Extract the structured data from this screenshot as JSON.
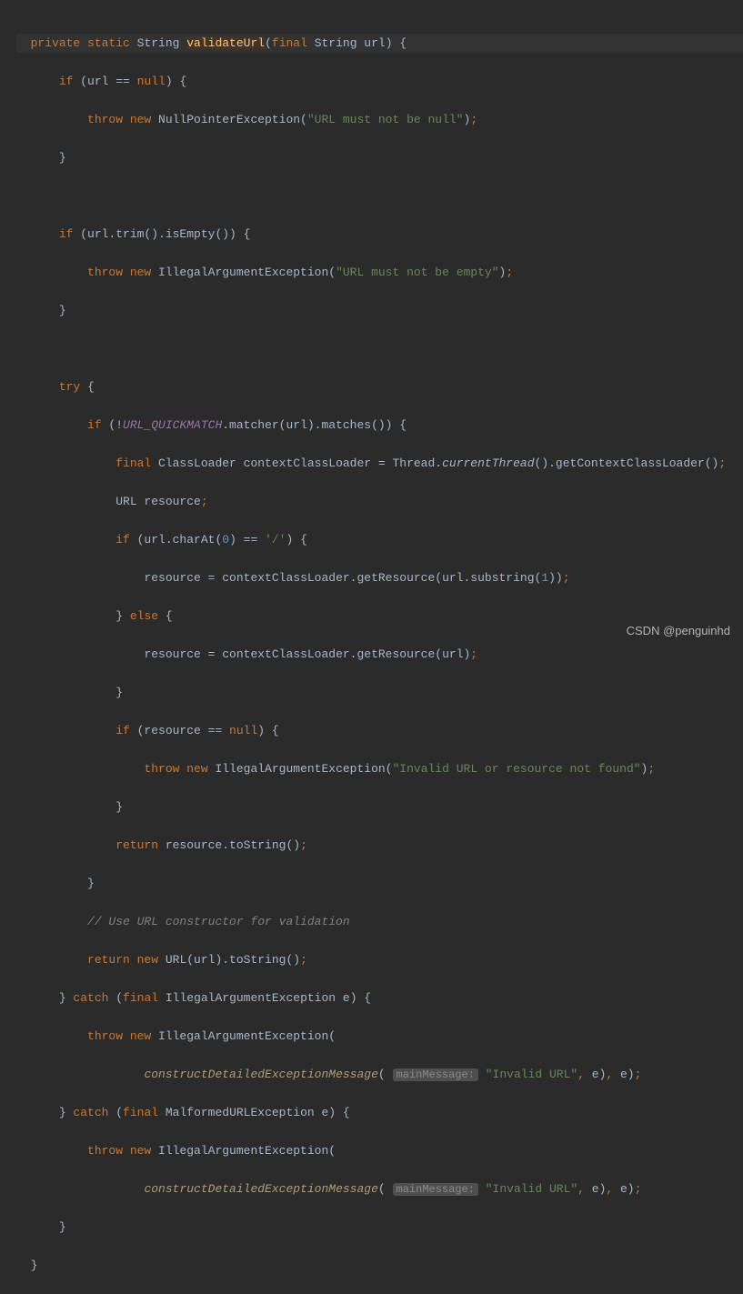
{
  "code": {
    "l1": {
      "a": "private static ",
      "b": "String ",
      "c": "validateUrl",
      "d": "(",
      "e": "final ",
      "f": "String url) {"
    },
    "l2": {
      "a": "if ",
      "b": "(url == ",
      "c": "null",
      "d": ") {"
    },
    "l3": {
      "a": "throw new ",
      "b": "NullPointerException(",
      "c": "\"URL must not be null\"",
      "d": ")",
      "e": ";"
    },
    "l4": {
      "a": "}"
    },
    "l5": {
      "a": "if ",
      "b": "(url.trim().isEmpty()) {"
    },
    "l6": {
      "a": "throw new ",
      "b": "IllegalArgumentException(",
      "c": "\"URL must not be empty\"",
      "d": ")",
      "e": ";"
    },
    "l7": {
      "a": "}"
    },
    "l8": {
      "a": "try ",
      "b": "{"
    },
    "l9": {
      "a": "if ",
      "b": "(!",
      "c": "URL_QUICKMATCH",
      "d": ".matcher(url).matches()) {"
    },
    "l10": {
      "a": "final ",
      "b": "ClassLoader contextClassLoader = Thread.",
      "c": "currentThread",
      "d": "().getContextClassLoader()",
      "e": ";"
    },
    "l11": {
      "a": "URL resource",
      "b": ";"
    },
    "l12": {
      "a": "if ",
      "b": "(url.charAt(",
      "c": "0",
      "d": ") == ",
      "e": "'/'",
      "f": ") {"
    },
    "l13": {
      "a": "resource = contextClassLoader.getResource(url.substring(",
      "b": "1",
      "c": "))",
      "d": ";"
    },
    "l14": {
      "a": "} ",
      "b": "else ",
      "c": "{"
    },
    "l15": {
      "a": "resource = contextClassLoader.getResource(url)",
      "b": ";"
    },
    "l16": {
      "a": "}"
    },
    "l17": {
      "a": "if ",
      "b": "(resource == ",
      "c": "null",
      "d": ") {"
    },
    "l18": {
      "a": "throw new ",
      "b": "IllegalArgumentException(",
      "c": "\"Invalid URL or resource not found\"",
      "d": ")",
      "e": ";"
    },
    "l19": {
      "a": "}"
    },
    "l20": {
      "a": "return ",
      "b": "resource.toString()",
      "c": ";"
    },
    "l21": {
      "a": "}"
    },
    "l22": {
      "a": "// Use URL constructor for validation"
    },
    "l23": {
      "a": "return new ",
      "b": "URL(url).toString()",
      "c": ";"
    },
    "l24": {
      "a": "} ",
      "b": "catch ",
      "c": "(",
      "d": "final ",
      "e": "IllegalArgumentException e) {"
    },
    "l25": {
      "a": "throw new ",
      "b": "IllegalArgumentException("
    },
    "l26": {
      "a": "constructDetailedExceptionMessage",
      "b": "(",
      "hint": "mainMessage:",
      "c": " ",
      "d": "\"Invalid URL\"",
      "e": ", ",
      "f": "e)",
      "g": ", ",
      "h": "e)",
      "i": ";"
    },
    "l27": {
      "a": "} ",
      "b": "catch ",
      "c": "(",
      "d": "final ",
      "e": "MalformedURLException e) {"
    },
    "l28": {
      "a": "throw new ",
      "b": "IllegalArgumentException("
    },
    "l29": {
      "a": "constructDetailedExceptionMessage",
      "b": "(",
      "hint": "mainMessage:",
      "c": " ",
      "d": "\"Invalid URL\"",
      "e": ", ",
      "f": "e)",
      "g": ", ",
      "h": "e)",
      "i": ";"
    },
    "l30": {
      "a": "}"
    },
    "l31": {
      "a": "}"
    }
  },
  "watermark": "CSDN @penguinhd"
}
